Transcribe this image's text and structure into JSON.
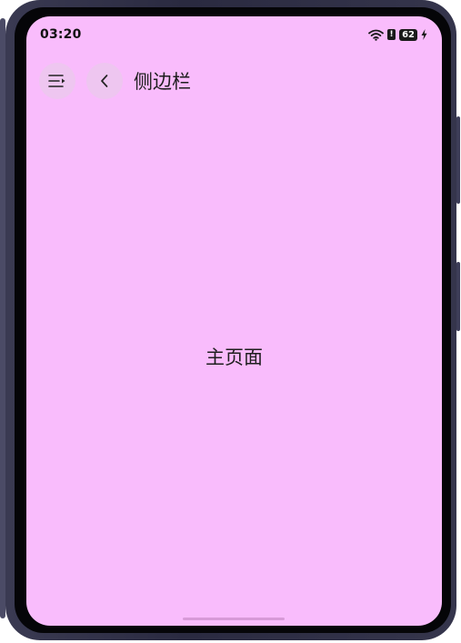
{
  "status_bar": {
    "time": "03:20",
    "alert": "!",
    "battery": "62"
  },
  "nav": {
    "title": "侧边栏"
  },
  "main": {
    "label": "主页面"
  },
  "icons": {
    "sidebar_toggle": "sidebar-toggle-icon",
    "back": "chevron-left-icon",
    "wifi": "wifi-icon",
    "charging": "lightning-icon"
  },
  "colors": {
    "screen_background": "#f9bcfc",
    "button_background": "#eec6f0",
    "text": "#1e1e1e"
  }
}
